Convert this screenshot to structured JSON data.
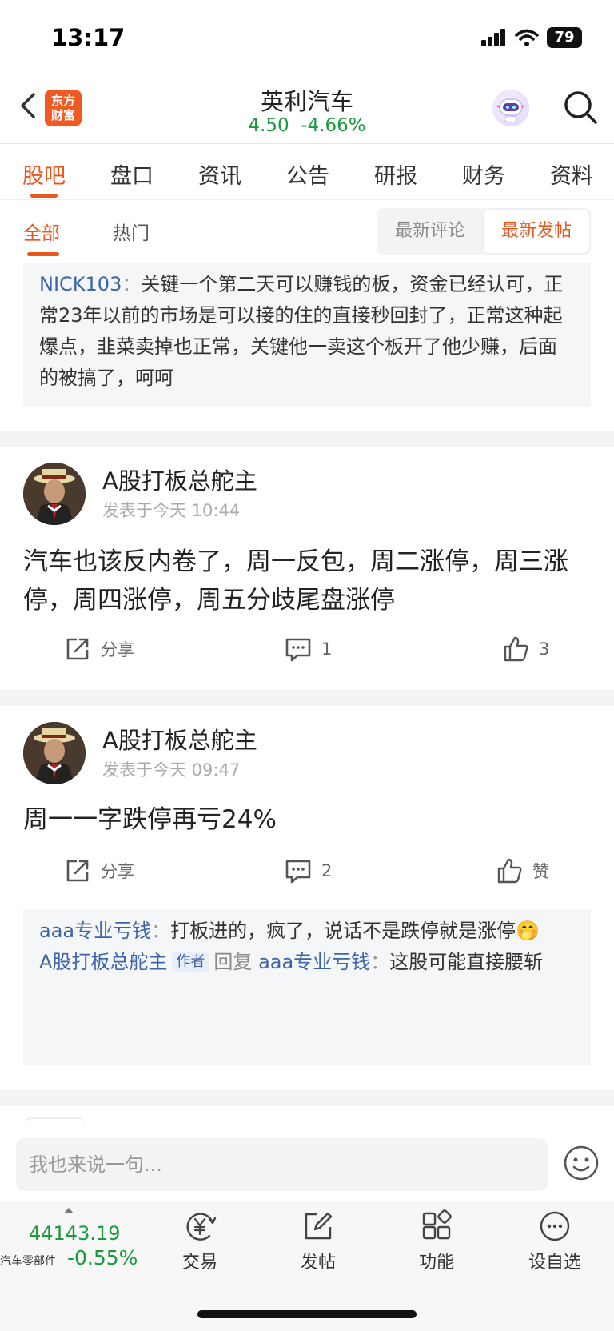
{
  "status_bar": {
    "time": "13:17",
    "battery": "79"
  },
  "header": {
    "logo_line1": "东方",
    "logo_line2": "财富",
    "stock_name": "英利汽车",
    "price": "4.50",
    "change": "-4.66%",
    "price_color": "#1a9a3c"
  },
  "tabs": [
    "股吧",
    "盘口",
    "资讯",
    "公告",
    "研报",
    "财务",
    "资料"
  ],
  "subtabs": {
    "all": "全部",
    "hot": "热门",
    "latest_comment": "最新评论",
    "latest_post": "最新发帖"
  },
  "top_quote": {
    "user": "NICK103",
    "colon": "：",
    "text": "关键一个第二天可以赚钱的板，资金已经认可，正常23年以前的市场是可以接的住的直接秒回封了，正常这种起爆点，韭菜卖掉也正常，关键他一卖这个板开了他少赚，后面的被搞了，呵呵"
  },
  "posts": [
    {
      "author": "A股打板总舵主",
      "time": "发表于今天 10:44",
      "body": "汽车也该反内卷了，周一反包，周二涨停，周三涨停，周四涨停，周五分歧尾盘涨停",
      "share": "分享",
      "comments": "1",
      "likes": "3"
    },
    {
      "author": "A股打板总舵主",
      "time": "发表于今天 09:47",
      "body": "周一一字跌停再亏24%",
      "share": "分享",
      "comments": "2",
      "likes": "赞",
      "replies": [
        {
          "user": "aaa专业亏钱",
          "colon": "：",
          "text": "打板进的，疯了，说话不是跌停就是涨停",
          "emoji": "🤭"
        },
        {
          "user": "A股打板总舵主",
          "tag": "作者",
          "reply_word": "回复",
          "target": "aaa专业亏钱",
          "colon": "：",
          "text": "这股可能直接腰斩"
        }
      ]
    }
  ],
  "composer": {
    "placeholder": "我也来说一句..."
  },
  "bottom_bar": {
    "index_value": "44143.19",
    "index_name": "汽车零部件",
    "index_change": "-0.55%",
    "nav": [
      "交易",
      "发帖",
      "功能",
      "设自选"
    ]
  },
  "colors": {
    "accent": "#e8581e",
    "down": "#1a9a3c",
    "link": "#3e64a8"
  }
}
